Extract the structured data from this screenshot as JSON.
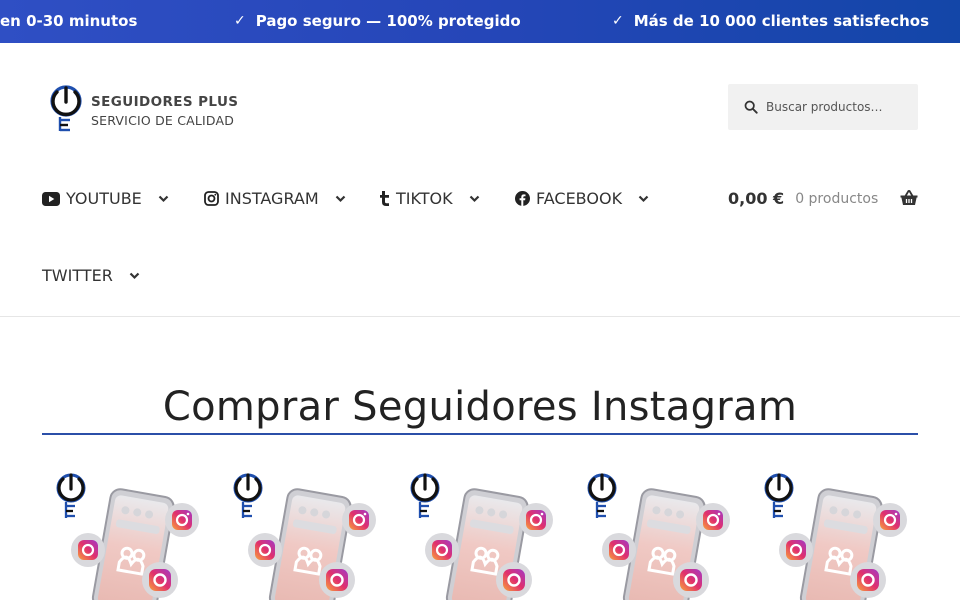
{
  "topbar": {
    "messages": [
      {
        "text": "en 0-30 minutos",
        "check": false
      },
      {
        "text": "Pago seguro — 100% protegido",
        "check": true
      },
      {
        "text": "Más de 10 000 clientes satisfechos",
        "check": true
      }
    ],
    "check_glyph": "✓"
  },
  "brand": {
    "title": "SEGUIDORES PLUS",
    "subtitle": "SERVICIO DE CALIDAD",
    "accent": "#1f4fae"
  },
  "search": {
    "placeholder": "Buscar productos…",
    "icon": "search-icon"
  },
  "nav": {
    "items": [
      {
        "label": "YOUTUBE",
        "icon": "youtube-icon"
      },
      {
        "label": "INSTAGRAM",
        "icon": "instagram-icon"
      },
      {
        "label": "TIKTOK",
        "icon": "tiktok-icon"
      },
      {
        "label": "FACEBOOK",
        "icon": "facebook-icon"
      },
      {
        "label": "TWITTER",
        "icon": "chevron-down-icon"
      }
    ]
  },
  "cart": {
    "total": "0,00 €",
    "count": "0 productos",
    "icon": "basket-icon"
  },
  "main": {
    "title": "Comprar Seguidores Instagram"
  },
  "products": [
    {
      "image": "instagram-followers-product-image"
    },
    {
      "image": "instagram-followers-product-image"
    },
    {
      "image": "instagram-followers-product-image"
    },
    {
      "image": "instagram-followers-product-image"
    },
    {
      "image": "instagram-followers-product-image"
    }
  ],
  "colors": {
    "banner_start": "#2f4fc4",
    "banner_end": "#1346a8",
    "title_underline": "#2b4fa8",
    "instagram_pink": "#e1306c"
  }
}
